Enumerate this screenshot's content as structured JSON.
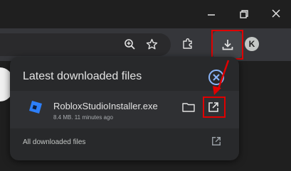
{
  "downloads": {
    "title": "Latest downloaded files",
    "items": [
      {
        "file_name": "RobloxStudioInstaller.exe",
        "meta": "8.4 MB. 11 minutes ago"
      }
    ],
    "all_downloads_label": "All downloaded files"
  },
  "profile": {
    "initial": "K"
  },
  "colors": {
    "annotation_red": "#e00000",
    "roblox_blue": "#2d7ff9",
    "panel_bg": "#28292b"
  },
  "icons": [
    "minimize-icon",
    "restore-icon",
    "close-icon",
    "zoom-icon",
    "bookmark-star-icon",
    "extensions-icon",
    "download-icon",
    "close-circle-icon",
    "roblox-studio-icon",
    "folder-icon",
    "open-external-icon"
  ]
}
